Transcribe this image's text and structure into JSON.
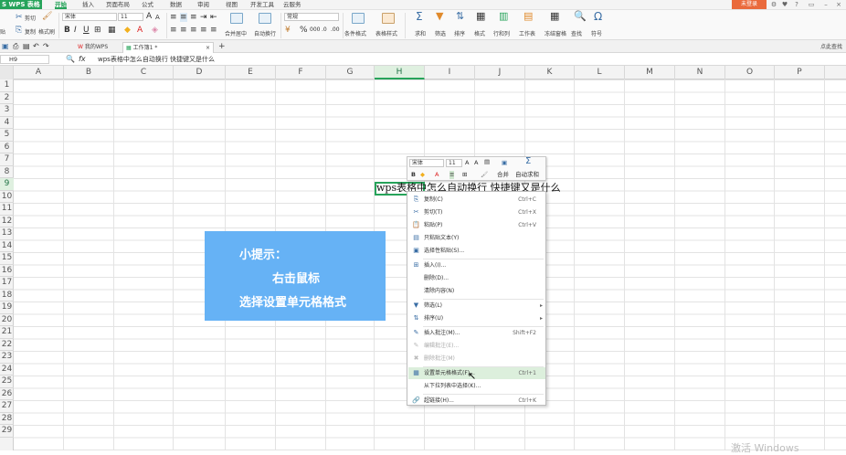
{
  "app": {
    "name": "S WPS 表格",
    "login_label": "未登录"
  },
  "menu": [
    "开始",
    "插入",
    "页面布局",
    "公式",
    "数据",
    "审阅",
    "视图",
    "开发工具",
    "云服务"
  ],
  "ribbon": {
    "clipboard": {
      "cut": "剪切",
      "copy": "复制",
      "format_painter": "格式刷",
      "paste_arrow": "贴"
    },
    "font_name": "宋体",
    "font_size": "11",
    "number_format": "常规",
    "merge_label": "合并居中",
    "wrap_label": "自动换行",
    "cond_format": "条件格式",
    "table_style": "表格样式",
    "sum_label": "求和",
    "filter_label": "筛选",
    "sort_label": "排序",
    "format_label": "格式",
    "rowcol_label": "行和列",
    "sheet_label": "工作表",
    "freeze_label": "冻结窗格",
    "find_label": "查找",
    "symbol_label": "符号"
  },
  "tabs": {
    "home": "我的WPS",
    "doc": "工作簿1 *",
    "add": "+",
    "right_action": "点此查找"
  },
  "formula_bar": {
    "cell_ref": "H9",
    "fx": "fx",
    "content": "wps表格中怎么自动换行 快捷键又是什么"
  },
  "columns": [
    "A",
    "B",
    "C",
    "D",
    "E",
    "F",
    "G",
    "H",
    "I",
    "J",
    "K",
    "L",
    "M",
    "N",
    "O",
    "P"
  ],
  "rows": [
    "1",
    "2",
    "3",
    "4",
    "5",
    "6",
    "7",
    "8",
    "9",
    "10",
    "11",
    "12",
    "13",
    "14",
    "15",
    "16",
    "17",
    "18",
    "19",
    "20",
    "21",
    "22",
    "23",
    "24",
    "25",
    "26",
    "27",
    "28",
    "29"
  ],
  "active_cell": {
    "col": "H",
    "row": "9",
    "text": "wps表格中怎么自动换行 快捷键又是什么"
  },
  "tip": {
    "line1": "小提示：",
    "line2": "右击鼠标",
    "line3": "选择设置单元格格式"
  },
  "mini_toolbar": {
    "font": "宋体",
    "size": "11",
    "merge": "合并",
    "autosum": "自动求和",
    "bold": "B"
  },
  "context_menu": [
    {
      "label": "复制(C)",
      "shortcut": "Ctrl+C",
      "icon": "copy-icon",
      "glyph": "⎘",
      "disabled": false
    },
    {
      "label": "剪切(T)",
      "shortcut": "Ctrl+X",
      "icon": "cut-icon",
      "glyph": "✂",
      "disabled": false
    },
    {
      "label": "粘贴(P)",
      "shortcut": "Ctrl+V",
      "icon": "paste-icon",
      "glyph": "📋",
      "disabled": false
    },
    {
      "label": "只粘贴文本(Y)",
      "shortcut": "",
      "icon": "paste-text-icon",
      "glyph": "▤",
      "disabled": false
    },
    {
      "label": "选择性粘贴(S)...",
      "shortcut": "",
      "icon": "paste-special-icon",
      "glyph": "▣",
      "disabled": false
    },
    {
      "label": "插入(I)...",
      "shortcut": "",
      "icon": "insert-icon",
      "glyph": "⊞",
      "disabled": false,
      "sep_before": true
    },
    {
      "label": "删除(D)...",
      "shortcut": "",
      "icon": "",
      "glyph": "",
      "disabled": false
    },
    {
      "label": "清除内容(N)",
      "shortcut": "",
      "icon": "",
      "glyph": "",
      "disabled": false
    },
    {
      "label": "筛选(L)",
      "shortcut": "",
      "icon": "filter-icon",
      "glyph": "▼",
      "disabled": false,
      "submenu": true,
      "sep_before": true
    },
    {
      "label": "排序(U)",
      "shortcut": "",
      "icon": "sort-icon",
      "glyph": "⇅",
      "disabled": false,
      "submenu": true
    },
    {
      "label": "插入批注(M)...",
      "shortcut": "Shift+F2",
      "icon": "comment-icon",
      "glyph": "✎",
      "disabled": false,
      "sep_before": true
    },
    {
      "label": "编辑批注(E)...",
      "shortcut": "",
      "icon": "edit-comment-icon",
      "glyph": "✎",
      "disabled": true
    },
    {
      "label": "删除批注(M)",
      "shortcut": "",
      "icon": "delete-comment-icon",
      "glyph": "✖",
      "disabled": true
    },
    {
      "label": "设置单元格格式(F)...",
      "shortcut": "Ctrl+1",
      "icon": "format-cells-icon",
      "glyph": "▦",
      "disabled": false,
      "highlight": true,
      "sep_before": true
    },
    {
      "label": "从下拉列表中选择(K)...",
      "shortcut": "",
      "icon": "",
      "glyph": "",
      "disabled": false
    },
    {
      "label": "超链接(H)...",
      "shortcut": "Ctrl+K",
      "icon": "hyperlink-icon",
      "glyph": "🔗",
      "disabled": false,
      "sep_before": true
    }
  ],
  "watermark": "激活 Windows",
  "colors": {
    "accent": "#26a35a",
    "tip_bg": "#66b2f5",
    "login": "#ea6a3c",
    "highlight": "#dcefdc"
  }
}
